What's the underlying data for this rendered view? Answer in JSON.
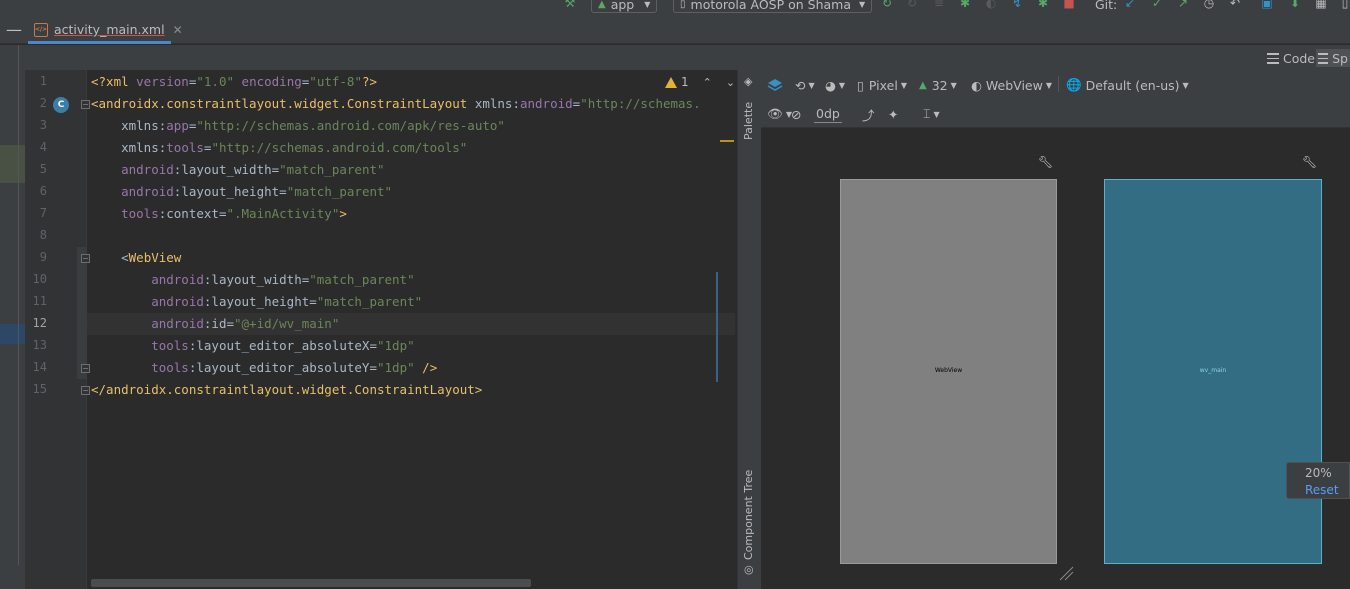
{
  "toolbar": {
    "run_config": "app",
    "device": "motorola AOSP on Shama",
    "git_label": "Git:"
  },
  "tabs": [
    {
      "label": "activity_main.xml",
      "icon": "xml-file-icon"
    }
  ],
  "view_modes": {
    "code": "Code",
    "split": "Sp"
  },
  "editor": {
    "warning_count": "1",
    "line_numbers": [
      "1",
      "2",
      "3",
      "4",
      "5",
      "6",
      "7",
      "8",
      "9",
      "10",
      "11",
      "12",
      "13",
      "14",
      "15"
    ],
    "current_line": "12",
    "lines": [
      [
        {
          "c": "pi",
          "t": "<?xml "
        },
        {
          "c": "attr",
          "t": "version"
        },
        {
          "c": "plain",
          "t": "="
        },
        {
          "c": "str",
          "t": "\"1.0\""
        },
        {
          "c": "plain",
          "t": " "
        },
        {
          "c": "attr",
          "t": "encoding"
        },
        {
          "c": "plain",
          "t": "="
        },
        {
          "c": "str",
          "t": "\"utf-8\""
        },
        {
          "c": "pi",
          "t": "?>"
        }
      ],
      [
        {
          "c": "tag",
          "t": "<androidx.constraintlayout.widget.ConstraintLayout "
        },
        {
          "c": "plain",
          "t": "xmlns:"
        },
        {
          "c": "ns",
          "t": "android"
        },
        {
          "c": "plain",
          "t": "="
        },
        {
          "c": "str",
          "t": "\"http://schemas."
        }
      ],
      [
        {
          "c": "plain",
          "t": "    xmlns:"
        },
        {
          "c": "ns",
          "t": "app"
        },
        {
          "c": "plain",
          "t": "="
        },
        {
          "c": "str",
          "t": "\"http://schemas.android.com/apk/res-auto\""
        }
      ],
      [
        {
          "c": "plain",
          "t": "    xmlns:"
        },
        {
          "c": "ns",
          "t": "tools"
        },
        {
          "c": "plain",
          "t": "="
        },
        {
          "c": "str",
          "t": "\"http://schemas.android.com/tools\""
        }
      ],
      [
        {
          "c": "ns",
          "t": "    android"
        },
        {
          "c": "plain",
          "t": ":layout_width="
        },
        {
          "c": "str",
          "t": "\"match_parent\""
        }
      ],
      [
        {
          "c": "ns",
          "t": "    android"
        },
        {
          "c": "plain",
          "t": ":layout_height="
        },
        {
          "c": "str",
          "t": "\"match_parent\""
        }
      ],
      [
        {
          "c": "ns",
          "t": "    tools"
        },
        {
          "c": "plain",
          "t": ":context="
        },
        {
          "c": "str",
          "t": "\".MainActivity\""
        },
        {
          "c": "tag",
          "t": ">"
        }
      ],
      [],
      [
        {
          "c": "plain",
          "t": "    <"
        },
        {
          "c": "tag",
          "t": "WebView"
        }
      ],
      [
        {
          "c": "ns",
          "t": "        android"
        },
        {
          "c": "plain",
          "t": ":layout_width="
        },
        {
          "c": "str",
          "t": "\"match_parent\""
        }
      ],
      [
        {
          "c": "ns",
          "t": "        android"
        },
        {
          "c": "plain",
          "t": ":layout_height="
        },
        {
          "c": "str",
          "t": "\"match_parent\""
        }
      ],
      [
        {
          "c": "ns",
          "t": "        android"
        },
        {
          "c": "plain",
          "t": ":id="
        },
        {
          "c": "str",
          "t": "\"@+id/wv_main\""
        }
      ],
      [
        {
          "c": "ns",
          "t": "        tools"
        },
        {
          "c": "plain",
          "t": ":layout_editor_absoluteX="
        },
        {
          "c": "str",
          "t": "\"1dp\""
        }
      ],
      [
        {
          "c": "ns",
          "t": "        tools"
        },
        {
          "c": "plain",
          "t": ":layout_editor_absoluteY="
        },
        {
          "c": "str",
          "t": "\"1dp\""
        },
        {
          "c": "tag",
          "t": " />"
        }
      ],
      [
        {
          "c": "tag",
          "t": "</androidx.constraintlayout.widget.ConstraintLayout>"
        }
      ]
    ]
  },
  "side_panels": {
    "palette": "Palette",
    "component_tree": "Component Tree"
  },
  "design_toolbar": {
    "device": "Pixel",
    "api": "32",
    "theme": "WebView",
    "locale": "Default (en-us)",
    "margin": "0dp"
  },
  "canvas": {
    "design_label": "WebView",
    "blueprint_label": "wv_main",
    "zoom": "20%",
    "reset": "Reset"
  },
  "colors": {
    "accent": "#4a88c7",
    "blueprint": "#326d83",
    "design": "#808080",
    "warning": "#e2b13c"
  }
}
